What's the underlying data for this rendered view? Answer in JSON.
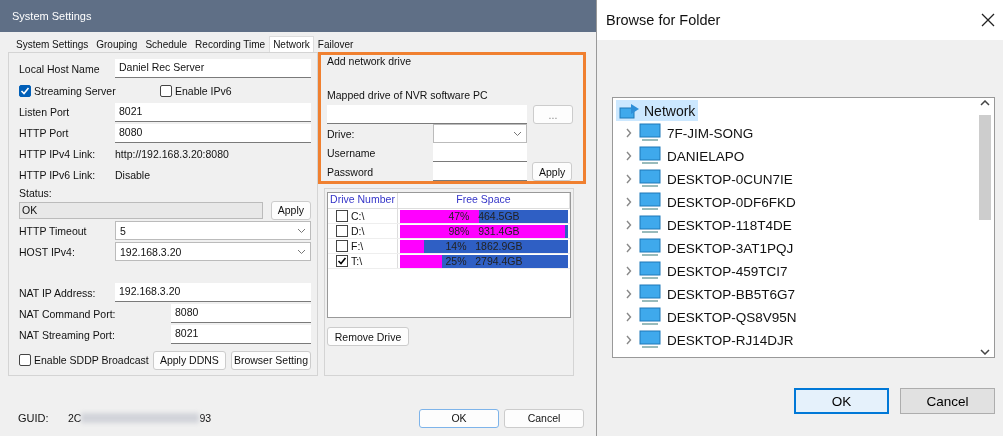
{
  "settings_window": {
    "title": "System Settings",
    "tabs": [
      {
        "label": "System Settings",
        "selected": false
      },
      {
        "label": "Grouping",
        "selected": false
      },
      {
        "label": "Schedule",
        "selected": false
      },
      {
        "label": "Recording Time",
        "selected": false
      },
      {
        "label": "Network",
        "selected": true
      },
      {
        "label": "Failover",
        "selected": false
      }
    ],
    "host_name": {
      "label": "Local Host Name",
      "value": "Daniel Rec Server"
    },
    "streaming_server": {
      "label": "Streaming Server",
      "checked": true
    },
    "enable_ipv6": {
      "label": "Enable IPv6",
      "checked": false
    },
    "fields": [
      {
        "kind": "input",
        "label": "Listen Port",
        "value": "8021"
      },
      {
        "kind": "input",
        "label": "HTTP Port",
        "value": "8080"
      },
      {
        "kind": "readout",
        "label": "HTTP IPv4 Link:",
        "value": "http://192.168.3.20:8080"
      },
      {
        "kind": "readout",
        "label": "HTTP IPv6 Link:",
        "value": "Disable"
      }
    ],
    "status": {
      "label": "Status:",
      "value": "OK",
      "button": "Apply"
    },
    "selects": [
      {
        "label": "HTTP Timeout",
        "value": "5"
      },
      {
        "label": "HOST IPv4:",
        "value": "192.168.3.20"
      }
    ],
    "nat_fields": [
      {
        "kind": "input",
        "label": "NAT IP Address:",
        "value": "192.168.3.20"
      },
      {
        "kind": "input_short",
        "label": "NAT Command Port:",
        "value": "8080"
      },
      {
        "kind": "input_short",
        "label": "NAT Streaming Port:",
        "value": "8021"
      }
    ],
    "sddp": {
      "label": "Enable SDDP Broadcast",
      "checked": false
    },
    "bottom_buttons": [
      "Apply DDNS",
      "Browser Setting"
    ],
    "network_drive": {
      "title": "Add network drive",
      "mapped_label": "Mapped drive of NVR software PC",
      "browse_button": "...",
      "drive_label": "Drive:",
      "username_label": "Username",
      "password_label": "Password",
      "apply_button": "Apply"
    },
    "drive_table": {
      "columns": [
        "Drive Number",
        "Free Space"
      ],
      "rows": [
        {
          "drive": "C:\\",
          "checked": false,
          "level": 0.47,
          "percent": "47%",
          "free": "464.5GB"
        },
        {
          "drive": "D:\\",
          "checked": false,
          "level": 0.98,
          "percent": "98%",
          "free": "931.4GB"
        },
        {
          "drive": "F:\\",
          "checked": false,
          "level": 0.14,
          "percent": "14%",
          "free": "1862.9GB"
        },
        {
          "drive": "T:\\",
          "checked": true,
          "level": 0.25,
          "percent": "25%",
          "free": "2794.4GB"
        }
      ]
    },
    "remove_button": "Remove Drive",
    "guid": {
      "label": "GUID:",
      "value_start": "2C",
      "value_end": "93"
    },
    "buttons": [
      "OK",
      "Cancel"
    ]
  },
  "browse_dialog": {
    "title": "Browse for Folder",
    "tree": [
      {
        "label": "Network",
        "selected": true,
        "children": [
          {
            "label": "7F-JIM-SONG",
            "expanded": false
          },
          {
            "label": "DANIELAPO",
            "expanded": false
          },
          {
            "label": "DESKTOP-0CUN7IE",
            "expanded": false
          },
          {
            "label": "DESKTOP-0DF6FKD",
            "expanded": false
          },
          {
            "label": "DESKTOP-118T4DE",
            "expanded": false
          },
          {
            "label": "DESKTOP-3AT1PQJ",
            "expanded": false
          },
          {
            "label": "DESKTOP-459TCI7",
            "expanded": false
          },
          {
            "label": "DESKTOP-BB5T6G7",
            "expanded": false
          },
          {
            "label": "DESKTOP-QS8V95N",
            "expanded": false
          },
          {
            "label": "DESKTOP-RJ14DJR",
            "expanded": false
          }
        ]
      }
    ],
    "buttons": [
      {
        "label": "OK",
        "focused": true
      },
      {
        "label": "Cancel",
        "focused": false
      }
    ]
  }
}
